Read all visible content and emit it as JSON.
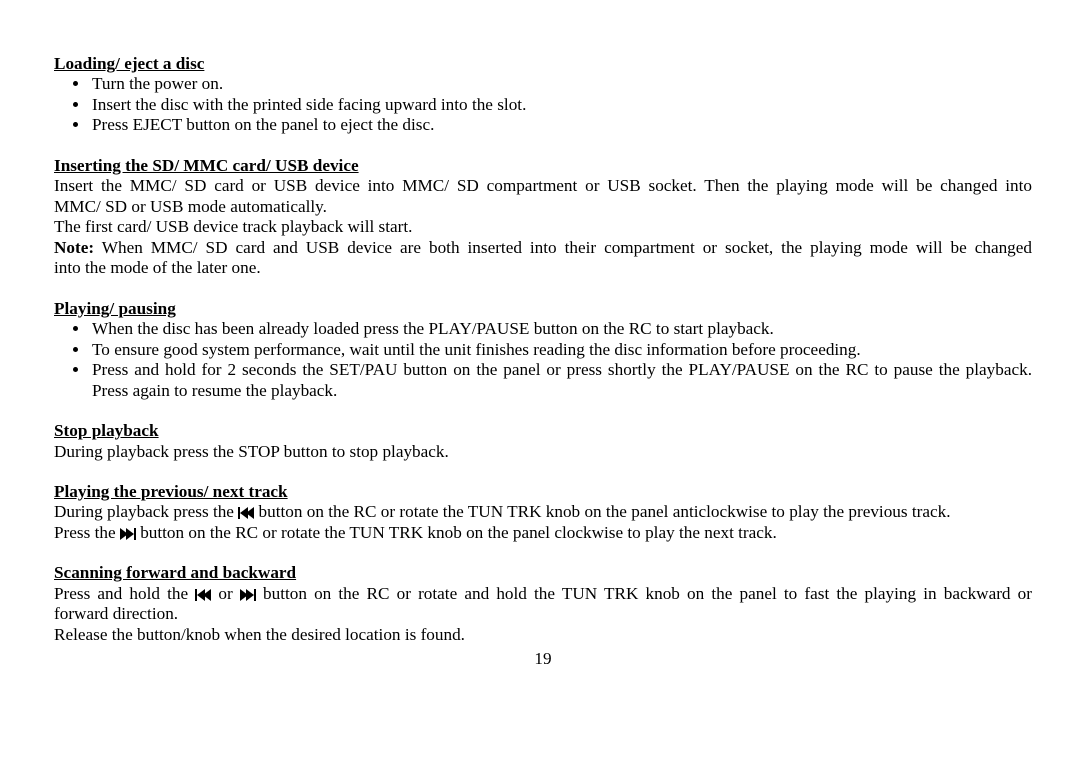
{
  "s1": {
    "heading": "Loading/ eject a disc",
    "items": [
      "Turn the power on.",
      "Insert the disc with the printed side facing upward into the slot.",
      "Press EJECT button on the panel to eject the disc."
    ]
  },
  "s2": {
    "heading": "Inserting the SD/ MMC card/ USB device",
    "p1a": "Insert the MMC/ SD card or USB device into MMC/ SD compartment or USB socket. Then the playing mode will be changed into",
    "p1b": "MMC/ SD or USB mode automatically.",
    "p2": "The first card/ USB device track playback will start.",
    "note_label": "Note:",
    "note_a": " When MMC/ SD card and USB device are both inserted into their compartment or socket, the playing mode will be changed",
    "note_b": "into the mode of the later one."
  },
  "s3": {
    "heading": "Playing/ pausing",
    "items": [
      "When the disc has been already loaded press the PLAY/PAUSE button on the RC to start playback.",
      "To ensure good system performance, wait until the unit finishes reading the disc information before proceeding.",
      "Press and hold for 2 seconds the SET/PAU button on the panel or press shortly the PLAY/PAUSE on the RC to pause the playback. Press again to resume the playback."
    ]
  },
  "s4": {
    "heading": "Stop playback",
    "p1": "During playback press the STOP button to stop playback."
  },
  "s5": {
    "heading": "Playing the previous/ next track",
    "p1_a": "During playback press the ",
    "p1_b": " button on the RC or rotate the TUN TRK knob on the panel anticlockwise to play the previous track.",
    "p2_a": "Press the ",
    "p2_b": " button on the RC or rotate the TUN TRK knob on the panel clockwise to play the next track."
  },
  "s6": {
    "heading": "Scanning forward and backward",
    "p1_a": "Press and hold the ",
    "p1_or": " or ",
    "p1_b": " button on the RC or rotate and hold the TUN TRK knob on the panel to fast the playing in backward or",
    "p1_c": "forward direction.",
    "p2": "Release the button/knob when the desired location is found."
  },
  "page_number": "19"
}
